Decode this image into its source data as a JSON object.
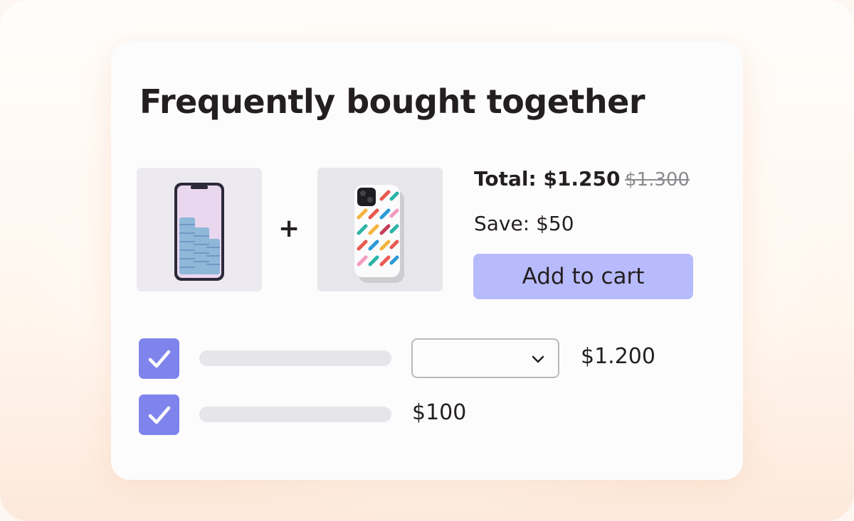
{
  "widget": {
    "title": "Frequently bought together",
    "plus": "+",
    "total_label": "Total: $1.250",
    "original_total": "$1.300",
    "save_label": "Save: $50",
    "add_to_cart": "Add to cart"
  },
  "products": [
    {
      "image_icon": "smartphone-image-icon",
      "checked": true,
      "price": "$1.200",
      "has_variant_select": true
    },
    {
      "image_icon": "phone-case-image-icon",
      "checked": true,
      "price": "$100",
      "has_variant_select": false
    }
  ],
  "colors": {
    "accent": "#7f84ec",
    "button": "#b8bbfb",
    "text": "#231f20"
  }
}
